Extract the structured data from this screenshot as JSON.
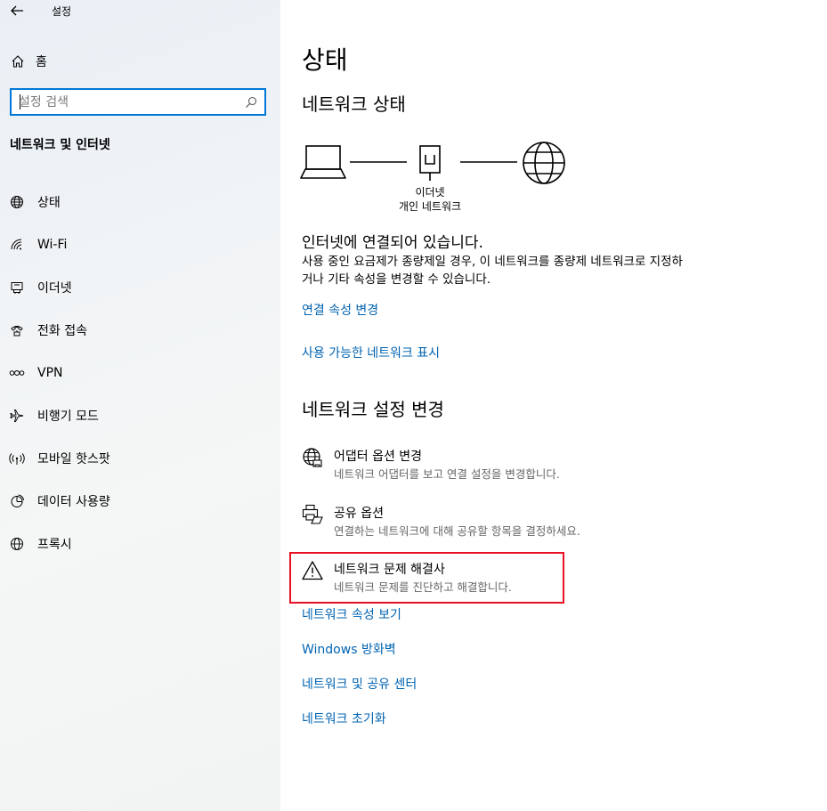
{
  "window": {
    "title": "설정"
  },
  "sidebar": {
    "home_label": "홈",
    "search_placeholder": "설정 검색",
    "section_title": "네트워크 및 인터넷",
    "items": [
      {
        "label": "상태",
        "icon": "status-globe-icon"
      },
      {
        "label": "Wi-Fi",
        "icon": "wifi-icon"
      },
      {
        "label": "이더넷",
        "icon": "ethernet-icon"
      },
      {
        "label": "전화 접속",
        "icon": "dialup-icon"
      },
      {
        "label": "VPN",
        "icon": "vpn-icon"
      },
      {
        "label": "비행기 모드",
        "icon": "airplane-icon"
      },
      {
        "label": "모바일 핫스팟",
        "icon": "hotspot-icon"
      },
      {
        "label": "데이터 사용량",
        "icon": "data-usage-icon"
      },
      {
        "label": "프록시",
        "icon": "proxy-globe-icon"
      }
    ]
  },
  "main": {
    "title": "상태",
    "network_status_heading": "네트워크 상태",
    "diagram": {
      "connection_type": "이더넷",
      "network_profile": "개인 네트워크"
    },
    "status_text": "인터넷에 연결되어 있습니다.",
    "status_desc": "사용 중인 요금제가 종량제일 경우, 이 네트워크를 종량제 네트워크로 지정하거나 기타 속성을 변경할 수 있습니다.",
    "link_change_properties": "연결 속성 변경",
    "link_show_networks": "사용 가능한 네트워크 표시",
    "change_settings_heading": "네트워크 설정 변경",
    "options": [
      {
        "title": "어댑터 옵션 변경",
        "desc": "네트워크 어댑터를 보고 연결 설정을 변경합니다.",
        "icon": "adapter-globe-icon"
      },
      {
        "title": "공유 옵션",
        "desc": "연결하는 네트워크에 대해 공유할 항목을 결정하세요.",
        "icon": "sharing-printer-icon"
      },
      {
        "title": "네트워크 문제 해결사",
        "desc": "네트워크 문제를 진단하고 해결합니다.",
        "icon": "warning-icon"
      }
    ],
    "links": [
      "네트워크 속성 보기",
      "Windows 방화벽",
      "네트워크 및 공유 센터",
      "네트워크 초기화"
    ]
  },
  "colors": {
    "accent": "#0078d7",
    "link": "#0063b1",
    "highlight": "#e81123"
  }
}
